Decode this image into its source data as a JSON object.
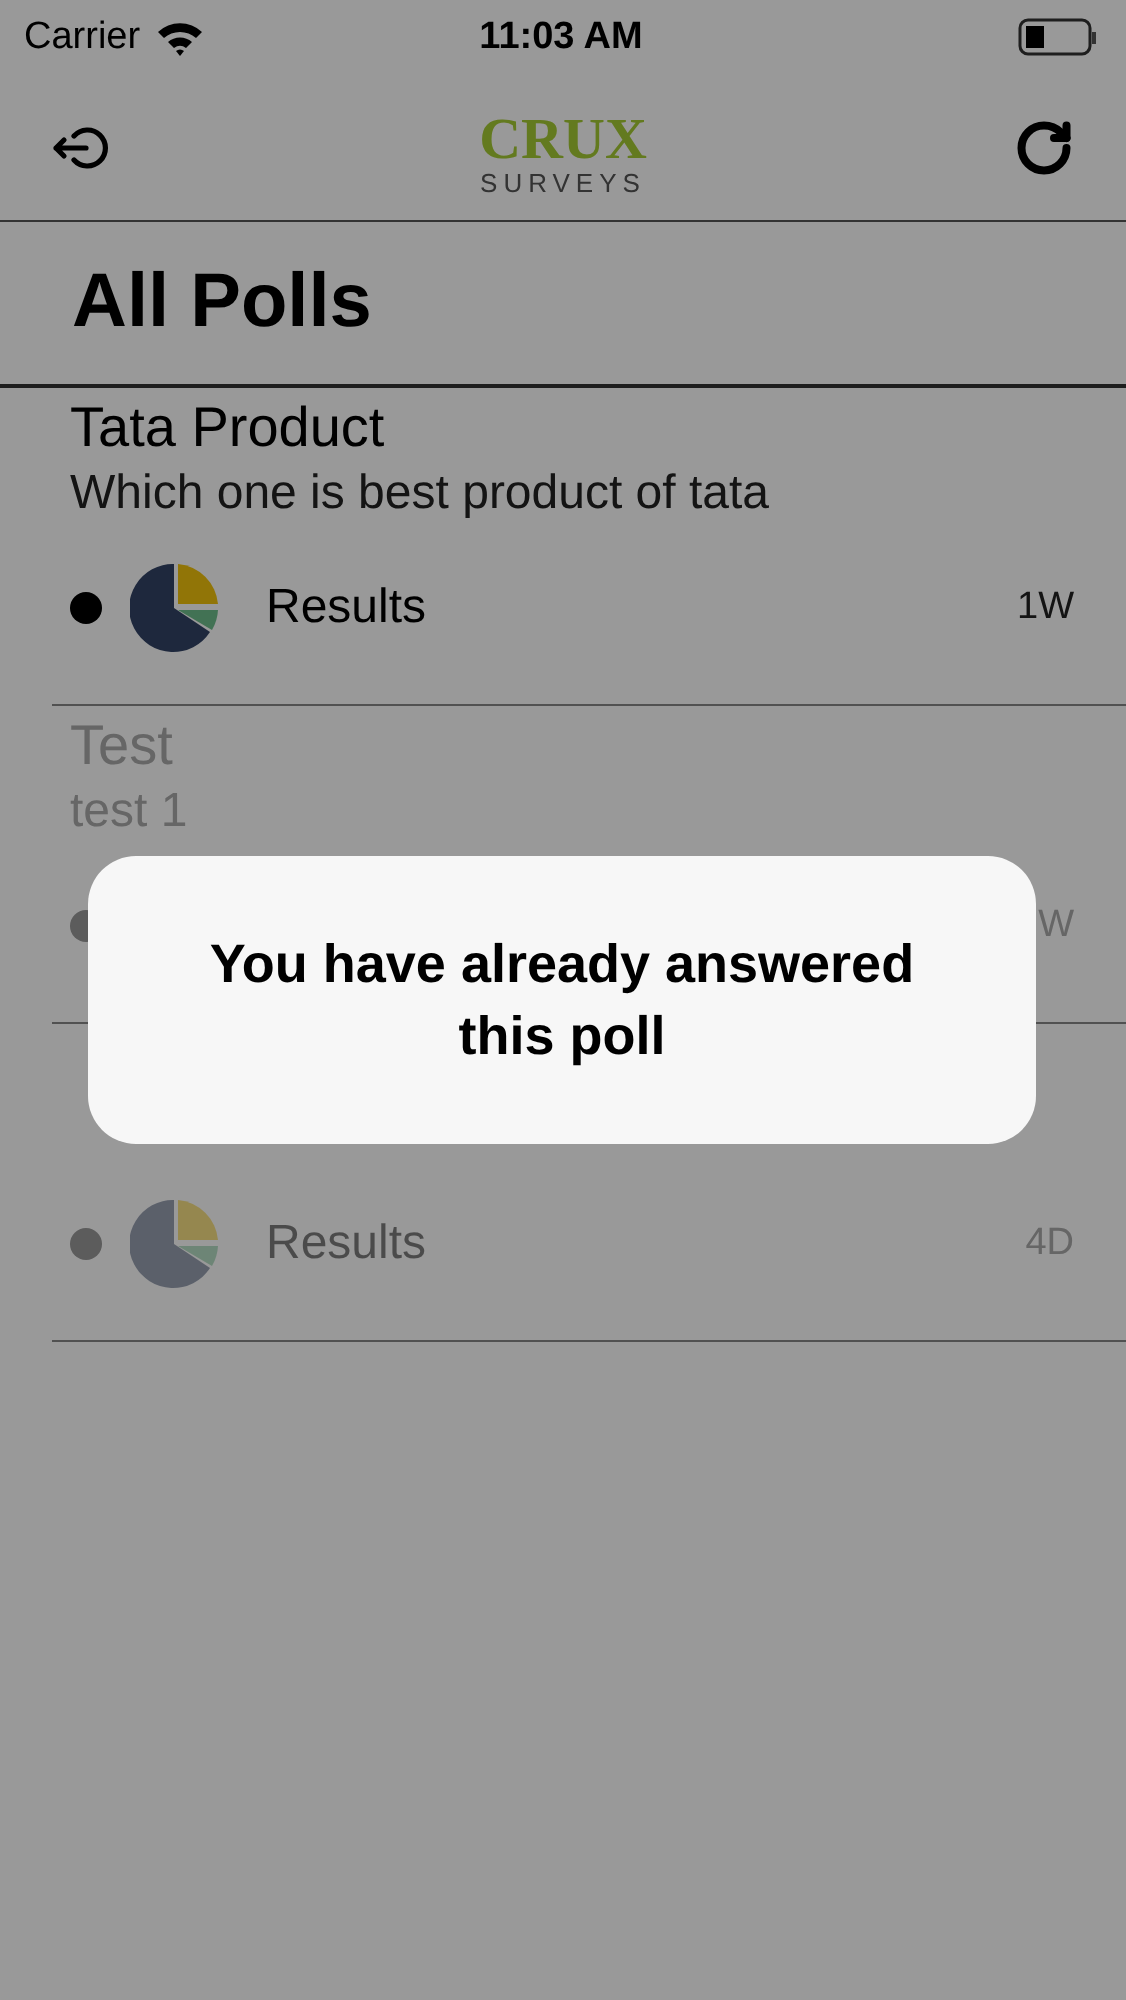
{
  "status_bar": {
    "carrier": "Carrier",
    "time": "11:03 AM"
  },
  "nav": {
    "logo_title": "CRUX",
    "logo_subtitle": "SURVEYS"
  },
  "page_title": "All Polls",
  "polls": [
    {
      "title": "Tata Product",
      "question": "Which one is best product of tata",
      "link": "Results",
      "age": "1W",
      "dimmed": false
    },
    {
      "title": "Test",
      "question": "test 1",
      "age": "W",
      "dimmed": true
    },
    {
      "link": "Results",
      "age": "4D",
      "dimmed": true
    }
  ],
  "alert": {
    "message": "You have already answered this poll"
  }
}
